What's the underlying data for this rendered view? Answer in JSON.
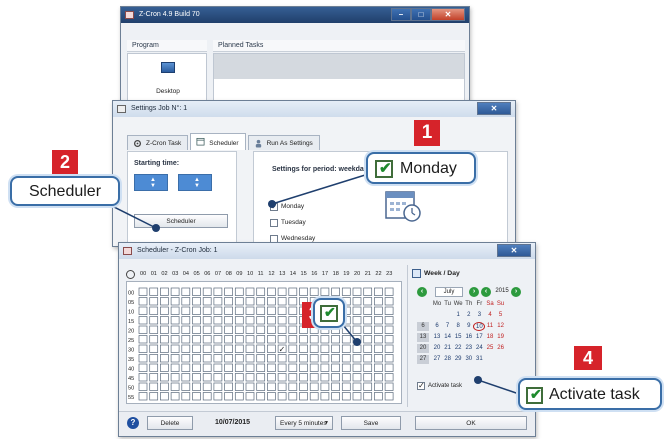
{
  "main_window": {
    "title": "Z-Cron 4.9 Build 70",
    "program_header": "Program",
    "planned_tasks_header": "Planned Tasks",
    "desktop_label": "Desktop"
  },
  "settings_window": {
    "title": "Settings Job N°: 1",
    "tabs": [
      {
        "label": "Z-Cron Task",
        "icon": "gear-icon"
      },
      {
        "label": "Scheduler",
        "icon": "calendar-icon"
      },
      {
        "label": "Run As Settings",
        "icon": "user-icon"
      }
    ],
    "starting_time_label": "Starting time:",
    "scheduler_button": "Scheduler",
    "period_label": "Settings for period: weekday",
    "weekdays": [
      {
        "label": "Monday",
        "checked": true
      },
      {
        "label": "Tuesday",
        "checked": false
      },
      {
        "label": "Wednesday",
        "checked": false
      }
    ]
  },
  "scheduler_window": {
    "title": "Scheduler - Z-Cron Job: 1",
    "hours": [
      "00",
      "01",
      "02",
      "03",
      "04",
      "05",
      "06",
      "07",
      "08",
      "09",
      "10",
      "11",
      "12",
      "13",
      "14",
      "15",
      "16",
      "17",
      "18",
      "19",
      "20",
      "21",
      "22",
      "23"
    ],
    "minutes": [
      "00",
      "05",
      "10",
      "15",
      "20",
      "25",
      "30",
      "35",
      "40",
      "45",
      "50",
      "55"
    ],
    "checked_cell": {
      "hour": "13",
      "minute": "30"
    },
    "calendar": {
      "title": "Week / Day",
      "month": "July",
      "year": "2015",
      "day_headers": [
        "Mo",
        "Tu",
        "We",
        "Th",
        "Fr",
        "Sa",
        "Su"
      ],
      "weeks": [
        {
          "wk": "",
          "days": [
            "",
            "",
            "1",
            "2",
            "3",
            "4",
            "5"
          ]
        },
        {
          "wk": "6",
          "days": [
            "6",
            "7",
            "8",
            "9",
            "10",
            "11",
            "12"
          ]
        },
        {
          "wk": "13",
          "days": [
            "13",
            "14",
            "15",
            "16",
            "17",
            "18",
            "19"
          ]
        },
        {
          "wk": "20",
          "days": [
            "20",
            "21",
            "22",
            "23",
            "24",
            "25",
            "26"
          ]
        },
        {
          "wk": "27",
          "days": [
            "27",
            "28",
            "29",
            "30",
            "31",
            "",
            ""
          ]
        }
      ],
      "today": "10",
      "activate_label": "Activate task",
      "activate_checked": true
    },
    "bottom": {
      "delete": "Delete",
      "date": "10/07/2015",
      "interval": "Every 5 minutes",
      "save": "Save",
      "ok": "OK"
    }
  },
  "callouts": {
    "c1": {
      "number": "1",
      "text": "Monday"
    },
    "c2": {
      "number": "2",
      "text": "Scheduler"
    },
    "c3": {
      "number": "3"
    },
    "c4": {
      "number": "4",
      "text": "Activate task"
    }
  },
  "colors": {
    "badge_red": "#d6232a",
    "callout_border": "#3a6ea7",
    "check_green": "#1e8a2d"
  }
}
